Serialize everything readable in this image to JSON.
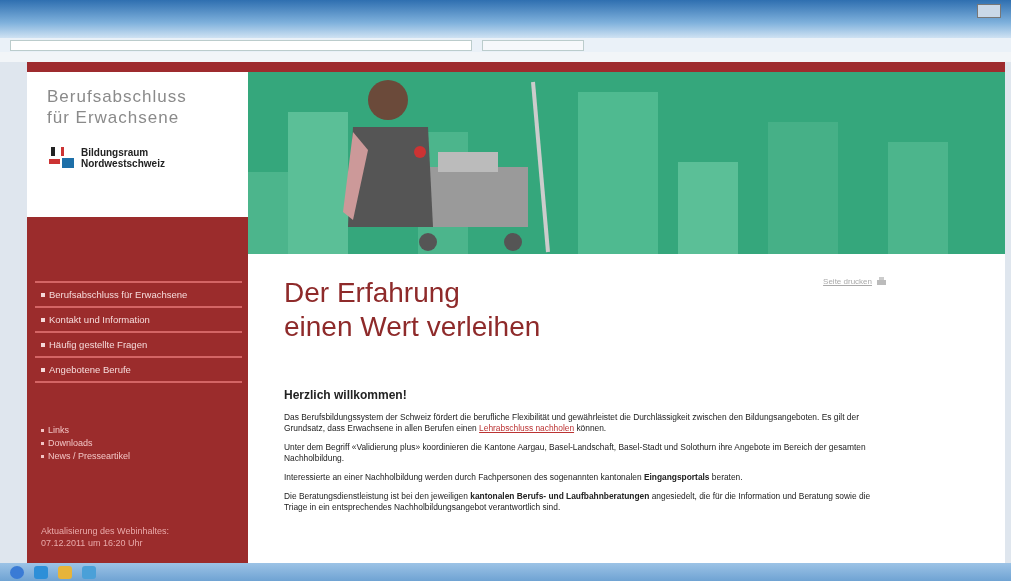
{
  "site": {
    "title_lines": [
      "Berufsabschluss",
      "für Erwachsene"
    ],
    "logo_lines": [
      "Bildungsraum",
      "Nordwestschweiz"
    ]
  },
  "main_nav": [
    {
      "label": "Berufsabschluss für Erwachsene"
    },
    {
      "label": "Kontakt und Information"
    },
    {
      "label": "Häufig gestellte Fragen"
    },
    {
      "label": "Angebotene Berufe"
    }
  ],
  "secondary_nav": [
    "Links",
    "Downloads",
    "News / Presseartikel"
  ],
  "update_note": [
    "Aktualisierung des Webinhaltes:",
    "07.12.2011 um 16:20 Uhr"
  ],
  "print_link": "Seite drucken",
  "headline": [
    "Der Erfahrung",
    "einen Wert verleihen"
  ],
  "welcome": "Herzlich willkommen!",
  "paragraphs": [
    [
      {
        "kind": "text",
        "text": "Das Berufsbildungssystem der Schweiz fördert die berufliche Flexibilität und gewährleistet die Durchlässigkeit zwischen den Bildungsangeboten. Es gilt der Grundsatz, dass Erwachsene in allen Berufen einen "
      },
      {
        "kind": "link",
        "text": "Lehrabschluss nachholen"
      },
      {
        "kind": "text",
        "text": " können."
      }
    ],
    [
      {
        "kind": "text",
        "text": "Unter dem Begriff «Validierung plus» koordinieren die Kantone Aargau, Basel-Landschaft, Basel-Stadt und Solothurn ihre Angebote im Bereich der gesamten Nachholbildung."
      }
    ],
    [
      {
        "kind": "text",
        "text": "Interessierte an einer Nachholbildung werden durch Fachpersonen des sogenannten kantonalen **Eingangsportals** beraten."
      }
    ],
    [
      {
        "kind": "text",
        "text": "Die Beratungsdienstleistung ist bei den jeweiligen **kantonalen Berufs- und Laufbahnberatungen** angesiedelt, die für die Information und Beratung sowie die Triage in ein entsprechendes Nachholbildungsangebot verantwortlich sind."
      }
    ]
  ]
}
